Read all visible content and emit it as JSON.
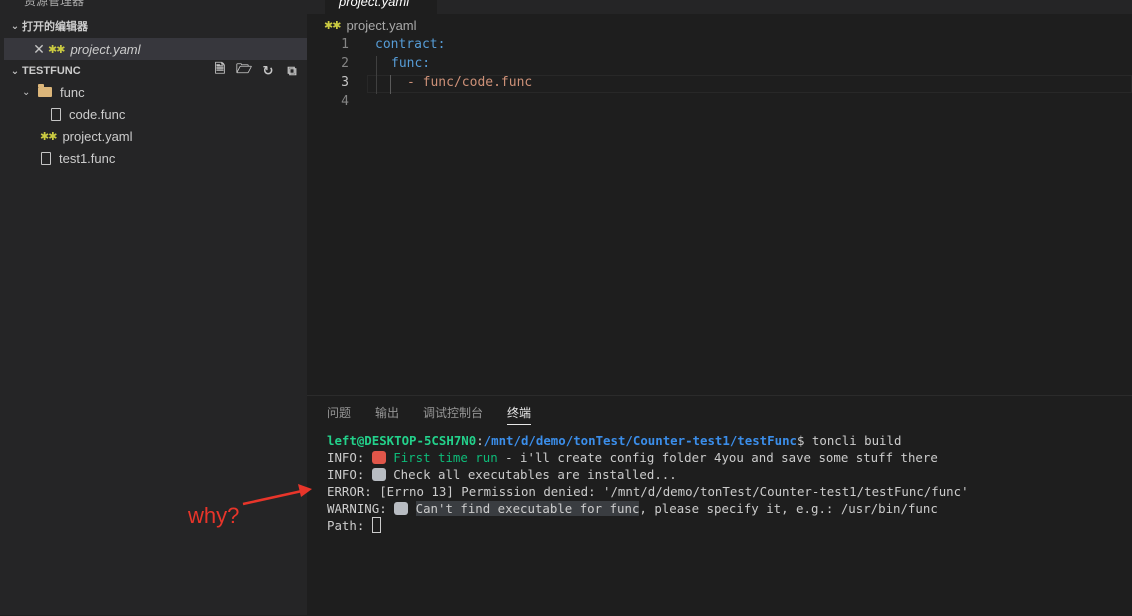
{
  "sidebar": {
    "top_label": "资源管理器",
    "open_editors_title": "打开的编辑器",
    "open_editor_file": "project.yaml",
    "folder_title": "TESTFUNC",
    "tree": {
      "folder_func": "func",
      "code_func": "code.func",
      "project_yaml": "project.yaml",
      "test1_func": "test1.func"
    }
  },
  "editor": {
    "tab_label": "project.yaml",
    "breadcrumb": "project.yaml",
    "lines": [
      {
        "num": "1",
        "text": "contract:"
      },
      {
        "num": "2",
        "text": "func:"
      },
      {
        "num": "3",
        "text": "- func/code.func"
      },
      {
        "num": "4",
        "text": ""
      }
    ]
  },
  "panel": {
    "tabs": [
      "问题",
      "输出",
      "调试控制台",
      "终端"
    ],
    "active_tab": "终端",
    "terminal": {
      "prompt_user": "left@DESKTOP-5CSH7N0",
      "prompt_sep": ":",
      "prompt_path": "/mnt/d/demo/tonTest/Counter-test1/testFunc",
      "prompt_cmd": "$ toncli build",
      "line2_prefix": "INFO: ",
      "line2_hl": "First time run",
      "line2_rest": " - i'll create config folder 4you and save some stuff there",
      "line3_prefix": "INFO: ",
      "line3_rest": " Check all executables are installed...",
      "line4": "ERROR: [Errno 13] Permission denied: '/mnt/d/demo/tonTest/Counter-test1/testFunc/func'",
      "line5_prefix": "WARNING: ",
      "line5_sel": "Can't find executable for func",
      "line5_rest": ", please specify it, e.g.: /usr/bin/func",
      "line6": "Path: "
    }
  },
  "annotation": {
    "text": "why?",
    "color": "#e8352a"
  }
}
